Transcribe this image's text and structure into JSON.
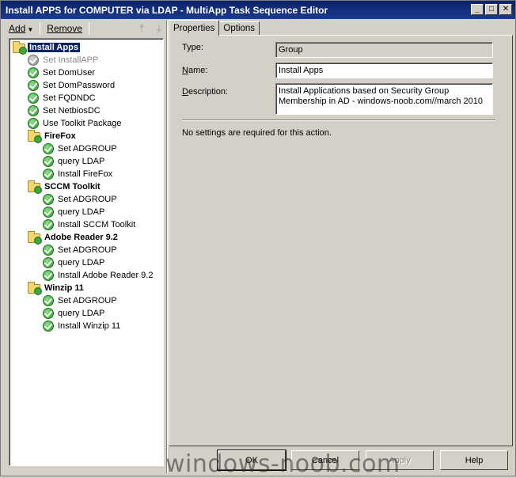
{
  "window": {
    "title": "Install APPS for COMPUTER via LDAP - MultiApp Task Sequence Editor",
    "controls": {
      "minimize": "_",
      "maximize": "□",
      "close": "✕"
    }
  },
  "toolbar": {
    "add_label": "Add",
    "remove_label": "Remove",
    "move_up_icon": "move-up-icon",
    "move_down_icon": "move-down-icon"
  },
  "tree": [
    {
      "label": "Install Apps",
      "type": "group",
      "level": 0,
      "selected": true,
      "disabled": false
    },
    {
      "label": "Set InstallAPP",
      "type": "step",
      "level": 1,
      "selected": false,
      "disabled": true
    },
    {
      "label": "Set DomUser",
      "type": "step",
      "level": 1,
      "selected": false,
      "disabled": false
    },
    {
      "label": "Set DomPassword",
      "type": "step",
      "level": 1,
      "selected": false,
      "disabled": false
    },
    {
      "label": "Set FQDNDC",
      "type": "step",
      "level": 1,
      "selected": false,
      "disabled": false
    },
    {
      "label": "Set NetbiosDC",
      "type": "step",
      "level": 1,
      "selected": false,
      "disabled": false
    },
    {
      "label": "Use Toolkit Package",
      "type": "step",
      "level": 1,
      "selected": false,
      "disabled": false
    },
    {
      "label": "FireFox",
      "type": "group",
      "level": 1,
      "selected": false,
      "disabled": false
    },
    {
      "label": "Set ADGROUP",
      "type": "step",
      "level": 2,
      "selected": false,
      "disabled": false
    },
    {
      "label": "query LDAP",
      "type": "step",
      "level": 2,
      "selected": false,
      "disabled": false
    },
    {
      "label": "Install FireFox",
      "type": "step",
      "level": 2,
      "selected": false,
      "disabled": false
    },
    {
      "label": "SCCM Toolkit",
      "type": "group",
      "level": 1,
      "selected": false,
      "disabled": false
    },
    {
      "label": "Set ADGROUP",
      "type": "step",
      "level": 2,
      "selected": false,
      "disabled": false
    },
    {
      "label": "query LDAP",
      "type": "step",
      "level": 2,
      "selected": false,
      "disabled": false
    },
    {
      "label": "Install SCCM Toolkit",
      "type": "step",
      "level": 2,
      "selected": false,
      "disabled": false
    },
    {
      "label": "Adobe Reader 9.2",
      "type": "group",
      "level": 1,
      "selected": false,
      "disabled": false
    },
    {
      "label": "Set ADGROUP",
      "type": "step",
      "level": 2,
      "selected": false,
      "disabled": false
    },
    {
      "label": "query LDAP",
      "type": "step",
      "level": 2,
      "selected": false,
      "disabled": false
    },
    {
      "label": "Install Adobe Reader 9.2",
      "type": "step",
      "level": 2,
      "selected": false,
      "disabled": false
    },
    {
      "label": "Winzip 11",
      "type": "group",
      "level": 1,
      "selected": false,
      "disabled": false
    },
    {
      "label": "Set ADGROUP",
      "type": "step",
      "level": 2,
      "selected": false,
      "disabled": false
    },
    {
      "label": "query LDAP",
      "type": "step",
      "level": 2,
      "selected": false,
      "disabled": false
    },
    {
      "label": "Install Winzip 11",
      "type": "step",
      "level": 2,
      "selected": false,
      "disabled": false
    }
  ],
  "tabs": [
    {
      "label": "Properties",
      "active": true
    },
    {
      "label": "Options",
      "active": false
    }
  ],
  "properties": {
    "type_label": "Type:",
    "type_value": "Group",
    "name_label": "Name:",
    "name_value": "Install Apps",
    "description_label": "Description:",
    "description_value": "Install Applications based on Security Group Membership in AD - windows-noob.com//march 2010",
    "note": "No settings are required  for this action."
  },
  "buttons": {
    "ok": "OK",
    "cancel": "Cancel",
    "apply": "Apply",
    "help": "Help"
  },
  "watermark": "windows-noob.com"
}
